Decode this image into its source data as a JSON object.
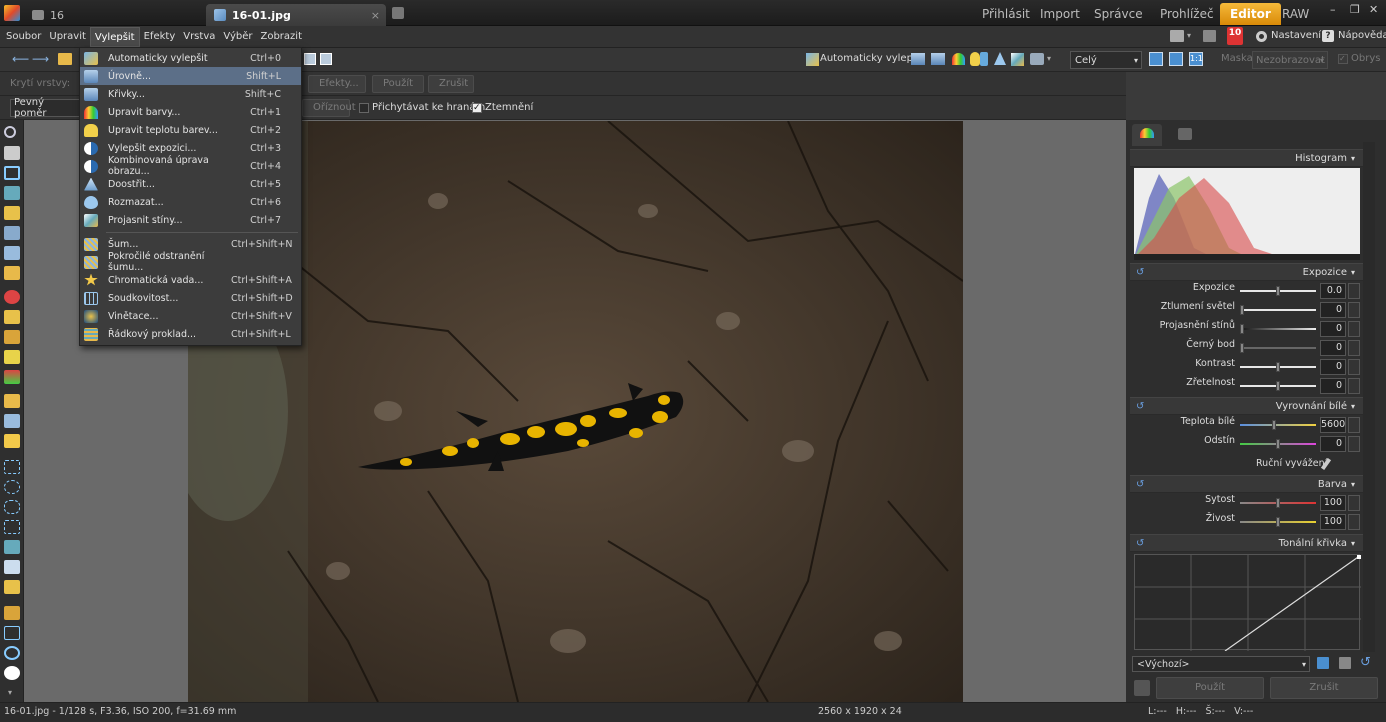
{
  "titlebar": {
    "tabs": [
      {
        "label": "16",
        "icon": "folder-icon"
      },
      {
        "label": "16-01.jpg",
        "icon": "edit-image-icon",
        "active": true
      }
    ],
    "close_tab": "×",
    "modules": [
      "Přihlásit",
      "Import",
      "Správce",
      "Prohlížeč",
      "Editor",
      "RAW"
    ],
    "active_module": "Editor",
    "window_controls": [
      "–",
      "❐",
      "✕"
    ]
  },
  "menubar": {
    "items": [
      "Soubor",
      "Upravit",
      "Vylepšit",
      "Efekty",
      "Vrstva",
      "Výběr",
      "Zobrazit"
    ],
    "open": "Vylepšit",
    "right": {
      "badge": "10",
      "settings": "Nastavení",
      "help": "Nápověda"
    }
  },
  "toolbar1": {
    "auto_enhance": "Automaticky vylepšit",
    "zoom_select": "Celý",
    "mask_label": "Maska:",
    "mask_select": "Nezobrazovat",
    "outline_label": "Obrys"
  },
  "toolbar2": {
    "layer_label": "Krytí vrstvy:",
    "buttons": [
      "Efekty...",
      "Použít",
      "Zrušit"
    ]
  },
  "toolbar3": {
    "ratio_select": "Pevný poměr",
    "crop_button": "Oříznout",
    "snap_label": "Přichytávat ke hranám",
    "dim_label": "Ztemnění"
  },
  "dropdown": {
    "items": [
      {
        "label": "Automaticky vylepšit",
        "shortcut": "Ctrl+0",
        "icon": "auto-enhance-icon"
      },
      {
        "label": "Úrovně...",
        "shortcut": "Shift+L",
        "icon": "levels-icon",
        "highlighted": true
      },
      {
        "label": "Křivky...",
        "shortcut": "Shift+C",
        "icon": "curves-icon"
      },
      {
        "label": "Upravit barvy...",
        "shortcut": "Ctrl+1",
        "icon": "color-rainbow-icon"
      },
      {
        "label": "Upravit teplotu barev...",
        "shortcut": "Ctrl+2",
        "icon": "bulb-icon"
      },
      {
        "label": "Vylepšit expozici...",
        "shortcut": "Ctrl+3",
        "icon": "exposure-icon"
      },
      {
        "label": "Kombinovaná úprava obrazu...",
        "shortcut": "Ctrl+4",
        "icon": "combined-icon"
      },
      {
        "label": "Doostřit...",
        "shortcut": "Ctrl+5",
        "icon": "sharpen-icon"
      },
      {
        "label": "Rozmazat...",
        "shortcut": "Ctrl+6",
        "icon": "blur-drop-icon"
      },
      {
        "label": "Projasnit stíny...",
        "shortcut": "Ctrl+7",
        "icon": "shadows-icon"
      },
      {
        "label": "Šum...",
        "shortcut": "Ctrl+Shift+N",
        "icon": "noise-icon"
      },
      {
        "label": "Pokročilé odstranění šumu...",
        "shortcut": "",
        "icon": "denoise-icon"
      },
      {
        "label": "Chromatická vada...",
        "shortcut": "Ctrl+Shift+A",
        "icon": "chromatic-icon"
      },
      {
        "label": "Soudkovitost...",
        "shortcut": "Ctrl+Shift+D",
        "icon": "barrel-icon"
      },
      {
        "label": "Vinětace...",
        "shortcut": "Ctrl+Shift+V",
        "icon": "vignette-icon"
      },
      {
        "label": "Řádkový proklad...",
        "shortcut": "Ctrl+Shift+L",
        "icon": "interlace-icon"
      }
    ]
  },
  "panel": {
    "histogram": "Histogram",
    "exposure_section": "Expozice",
    "exposure_rows": [
      {
        "label": "Expozice",
        "value": "0.0",
        "level": 0.5
      },
      {
        "label": "Ztlumení světel",
        "value": "0",
        "level": 0.0
      },
      {
        "label": "Projasnění stínů",
        "value": "0",
        "level": 0.0
      },
      {
        "label": "Černý bod",
        "value": "0",
        "level": 0.0
      },
      {
        "label": "Kontrast",
        "value": "0",
        "level": 0.5
      },
      {
        "label": "Zřetelnost",
        "value": "0",
        "level": 0.5
      }
    ],
    "wb_section": "Vyrovnání bílé",
    "wb_rows": [
      {
        "label": "Teplota bílé",
        "value": "5600",
        "level": 0.45
      },
      {
        "label": "Odstín",
        "value": "0",
        "level": 0.5
      }
    ],
    "manual_wb": "Ruční vyvážení",
    "color_section": "Barva",
    "color_rows": [
      {
        "label": "Sytost",
        "value": "100",
        "level": 0.5
      },
      {
        "label": "Živost",
        "value": "100",
        "level": 0.5
      }
    ],
    "curve_section": "Tonální křivka",
    "preset": "<Výchozí>",
    "apply": "Použít",
    "cancel": "Zrušit"
  },
  "status": {
    "left": "16-01.jpg - 1/128 s, F3.36, ISO 200, f=31.69 mm",
    "center": "2560 x 1920 x 24",
    "right": "L:---   H:---   Š:---   V:---"
  },
  "colors": {
    "accent": "#e89a14",
    "menu_highlight": "#5c6f88",
    "salamander_yellow": "#e8b400"
  }
}
